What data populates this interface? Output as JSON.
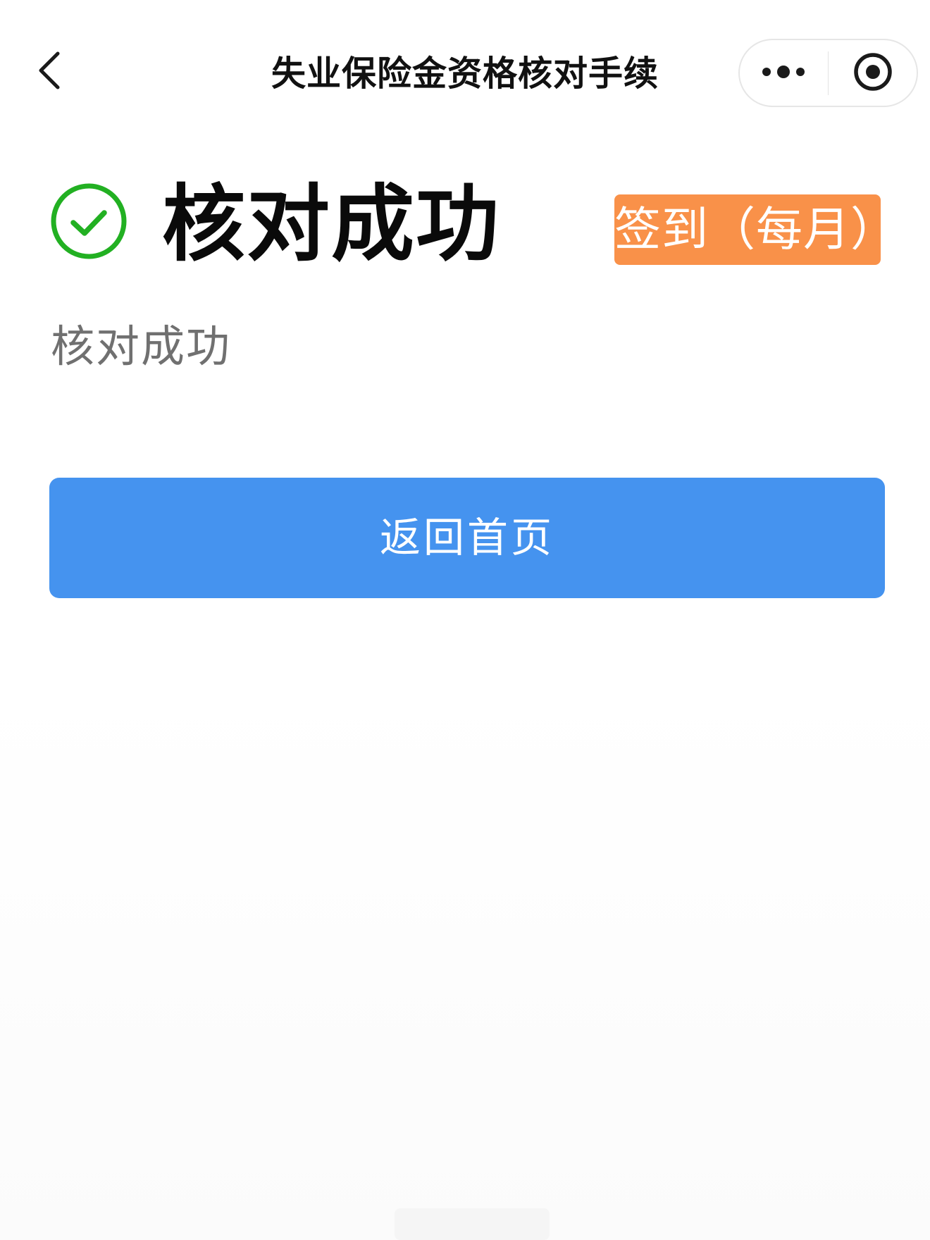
{
  "navbar": {
    "title": "失业保险金资格核对手续",
    "back_icon": "chevron-left-icon",
    "more_icon": "more-dots-icon",
    "close_icon": "target-circle-icon"
  },
  "result": {
    "status_icon": "check-circle-icon",
    "title": "核对成功",
    "badge": "签到（每月）",
    "description": "核对成功"
  },
  "actions": {
    "home_label": "返回首页"
  },
  "colors": {
    "success": "#22b022",
    "badge_bg": "#f99149",
    "primary": "#4593ef"
  }
}
